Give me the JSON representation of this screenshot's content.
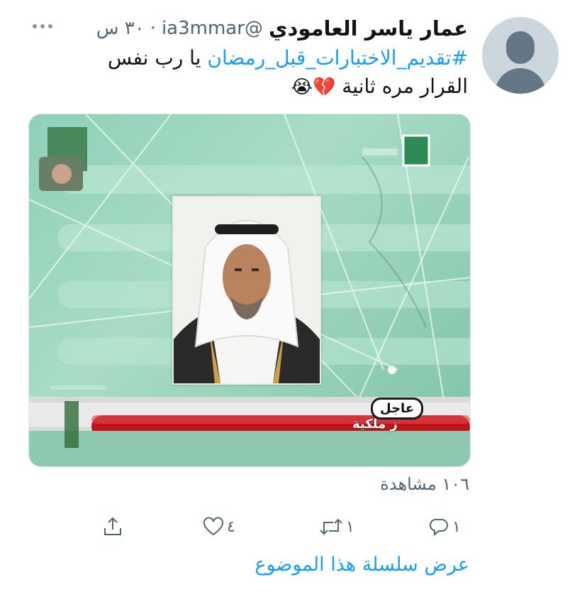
{
  "author": {
    "display_name": "عمار ياسر العامودي",
    "handle": "@ia3mmar",
    "separator": "·",
    "time": "٣٠ س"
  },
  "tweet": {
    "hashtag": "#تقديم_الاختبارات_قبل_رمضان",
    "text_after_hashtag": " يا رب نفس",
    "line2": "القرار مره ثانية ",
    "emojis": "💔😭"
  },
  "media": {
    "ticker_label": "عاجل",
    "ticker_text": "ز ملكية"
  },
  "views": "١٠٦ مشاهدة",
  "actions": {
    "reply_count": "١",
    "retweet_count": "١",
    "like_count": "٤"
  },
  "thread_link": "عرض سلسلة هذا الموضوع",
  "colors": {
    "accent": "#1d9bf0",
    "secondary_text": "#536471",
    "primary_text": "#0f1419"
  },
  "icons": {
    "more": "more-horizontal-icon",
    "reply": "reply-icon",
    "retweet": "retweet-icon",
    "like": "heart-icon",
    "share": "share-icon"
  }
}
